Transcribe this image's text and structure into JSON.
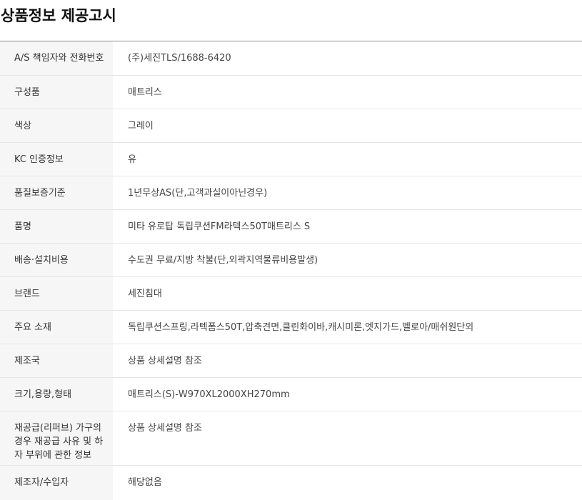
{
  "title": "상품정보 제공고시",
  "rows": [
    {
      "label": "A/S 책임자와 전화번호",
      "value": "(주)세진TLS/1688-6420"
    },
    {
      "label": "구성품",
      "value": "매트리스"
    },
    {
      "label": "색상",
      "value": "그레이"
    },
    {
      "label": "KC 인증정보",
      "value": "유"
    },
    {
      "label": "품질보증기준",
      "value": "1년무상AS(단,고객과실이아닌경우)"
    },
    {
      "label": "품명",
      "value": "미타 유로탑 독립쿠션FM라텍스50T매트리스 S"
    },
    {
      "label": "배송·설치비용",
      "value": "수도권 무료/지방 착불(단,외곽지역물류비용발생)"
    },
    {
      "label": "브랜드",
      "value": "세진침대"
    },
    {
      "label": "주요 소재",
      "value": "독립쿠션스프링,라텍폼스50T,압축견면,클린화이바,캐시미론,엣지가드,벨로아/매쉬원단외"
    },
    {
      "label": "제조국",
      "value": "상품 상세설명 참조"
    },
    {
      "label": "크기,용량,형태",
      "value": "매트리스(S)-W970XL2000XH270mm"
    },
    {
      "label": "재공급(리퍼브) 가구의 경우 재공급 사유 및 하자 부위에 관한 정보",
      "value": "상품 상세설명 참조"
    },
    {
      "label": "제조자/수입자",
      "value": "해당없음"
    }
  ]
}
